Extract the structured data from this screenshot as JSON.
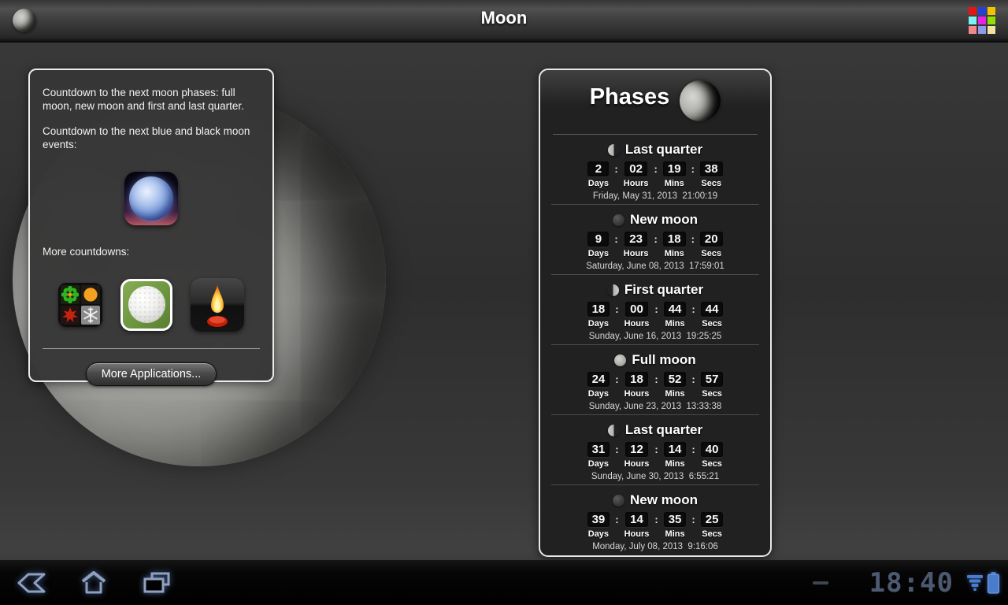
{
  "topbar": {
    "title": "Moon"
  },
  "left_panel": {
    "intro_1": "Countdown to the next moon phases: full moon, new moon and first and last quarter.",
    "intro_2": "Countdown to the next blue and black moon events:",
    "more_countdowns_label": "More countdowns:",
    "more_apps_button": "More Applications...",
    "app_icons": [
      "blue-moon-app-icon",
      "seasons-app-icon",
      "golf-app-icon",
      "candle-app-icon"
    ]
  },
  "phases_panel": {
    "title": "Phases",
    "colon": ":",
    "unit_labels": [
      "Days",
      "Hours",
      "Mins",
      "Secs"
    ],
    "entries": [
      {
        "name": "Last quarter",
        "icon": "last-quarter",
        "days": "2",
        "hours": "02",
        "mins": "19",
        "secs": "38",
        "date": "Friday, May 31, 2013  21:00:19"
      },
      {
        "name": "New moon",
        "icon": "new",
        "days": "9",
        "hours": "23",
        "mins": "18",
        "secs": "20",
        "date": "Saturday, June 08, 2013  17:59:01"
      },
      {
        "name": "First quarter",
        "icon": "first-quarter",
        "days": "18",
        "hours": "00",
        "mins": "44",
        "secs": "44",
        "date": "Sunday, June 16, 2013  19:25:25"
      },
      {
        "name": "Full moon",
        "icon": "full",
        "days": "24",
        "hours": "18",
        "mins": "52",
        "secs": "57",
        "date": "Sunday, June 23, 2013  13:33:38"
      },
      {
        "name": "Last quarter",
        "icon": "last-quarter",
        "days": "31",
        "hours": "12",
        "mins": "14",
        "secs": "40",
        "date": "Sunday, June 30, 2013  6:55:21"
      },
      {
        "name": "New moon",
        "icon": "new",
        "days": "39",
        "hours": "14",
        "mins": "35",
        "secs": "25",
        "date": "Monday, July 08, 2013  9:16:06"
      }
    ]
  },
  "system_bar": {
    "clock": "18:40",
    "icons": [
      "back-icon",
      "home-icon",
      "recent-apps-icon",
      "notification-minimize-icon",
      "signal-strength-icon",
      "battery-icon"
    ]
  },
  "colors": {
    "accent_blue": "#4a7ccc",
    "nav_icon_glow": "#8fa0bf",
    "panel_border": "#ededed",
    "digit_box_bg": "#0c0c0c",
    "apps_grid_squares": [
      "#e81414",
      "#2440d8",
      "#f0c400",
      "#7df2f2",
      "#ea1fea",
      "#8fe000",
      "#f28888",
      "#8e9ae8",
      "#f2e4a0"
    ]
  }
}
